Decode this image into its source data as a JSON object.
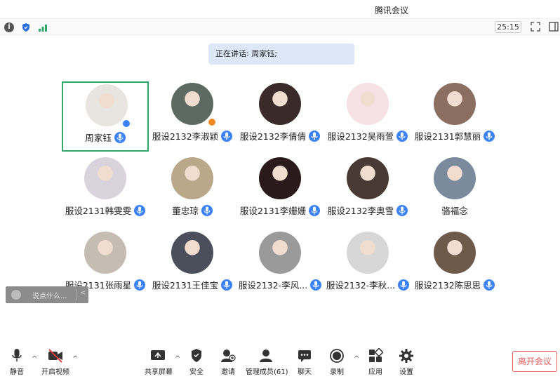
{
  "window": {
    "title": "腾讯会议"
  },
  "status": {
    "timer": "25:15"
  },
  "speaking": "正在讲话: 周家钰;",
  "participants": [
    {
      "name": "周家钰",
      "mic": true,
      "active": true,
      "avatar_bg": "#e8e4e0"
    },
    {
      "name": "服设2132李淑颖",
      "mic": true,
      "avatar_bg": "#5d6a62"
    },
    {
      "name": "服设2132李倩倩",
      "mic": true,
      "avatar_bg": "#3a2b2a"
    },
    {
      "name": "服设2132吴雨萱",
      "mic": true,
      "avatar_bg": "#f6e1e6"
    },
    {
      "name": "服设2131郭慧丽",
      "mic": true,
      "avatar_bg": "#8b6f60"
    },
    {
      "name": "服设2131韩雯雯",
      "mic": true,
      "avatar_bg": "#d9d4dc"
    },
    {
      "name": "董忠琼",
      "mic": true,
      "avatar_bg": "#b9a889"
    },
    {
      "name": "服设2131李姗姗",
      "mic": true,
      "avatar_bg": "#2a1a1c"
    },
    {
      "name": "服设2132李奥雪",
      "mic": true,
      "avatar_bg": "#4a3a35"
    },
    {
      "name": "骆福念",
      "mic": false,
      "avatar_bg": "#7c8a9e"
    },
    {
      "name": "服设2131张雨星",
      "mic": true,
      "avatar_bg": "#c6bdb2"
    },
    {
      "name": "服设2131王佳宝",
      "mic": true,
      "avatar_bg": "#4b4f5c"
    },
    {
      "name": "服设2132-李风...",
      "mic": true,
      "avatar_bg": "#9a9a9a"
    },
    {
      "name": "服设2132-李秋...",
      "mic": true,
      "avatar_bg": "#d7d7d7"
    },
    {
      "name": "服设2132陈思思",
      "mic": true,
      "avatar_bg": "#6e5a48"
    }
  ],
  "chat": {
    "placeholder": "说点什么..."
  },
  "toolbar": {
    "mute": "静音",
    "video": "开启视频",
    "share": "共享屏幕",
    "security": "安全",
    "invite": "邀请",
    "members": "管理成员(61)",
    "chat": "聊天",
    "record": "录制",
    "apps": "应用",
    "settings": "设置",
    "leave": "离开会议"
  },
  "colors": {
    "accent": "#3a82f6",
    "active_border": "#2fa86b",
    "leave": "#e45a5a"
  }
}
